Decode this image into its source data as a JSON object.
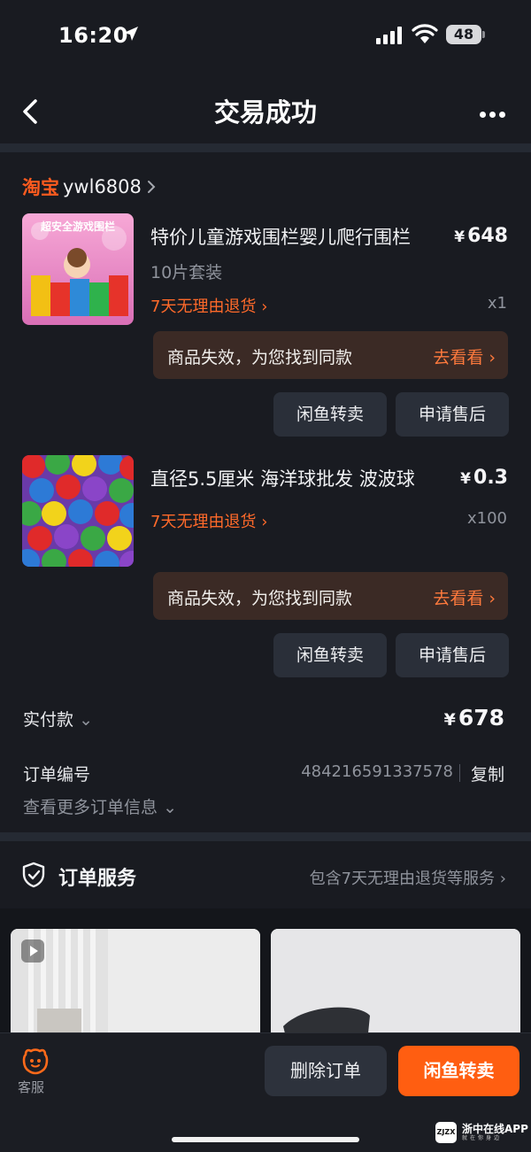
{
  "status_bar": {
    "time": "16:20",
    "battery": "48"
  },
  "nav": {
    "title": "交易成功"
  },
  "shop": {
    "platform": "淘宝",
    "name": "ywl6808"
  },
  "items": [
    {
      "title": "特价儿童游戏围栏婴儿爬行围栏",
      "sku": "10片套装",
      "return_tag": "7天无理由退货",
      "currency": "¥",
      "price": "648",
      "qty": "x1",
      "notice": "商品失效，为您找到同款",
      "notice_link": "去看看",
      "btn_resell": "闲鱼转卖",
      "btn_aftersale": "申请售后",
      "thumb_text": "超安全游戏围栏"
    },
    {
      "title": "直径5.5厘米 海洋球批发 波波球",
      "return_tag": "7天无理由退货",
      "currency": "¥",
      "price": "0.3",
      "qty": "x100",
      "notice": "商品失效，为您找到同款",
      "notice_link": "去看看",
      "btn_resell": "闲鱼转卖",
      "btn_aftersale": "申请售后"
    }
  ],
  "payment": {
    "label": "实付款",
    "currency": "¥",
    "amount": "678"
  },
  "order": {
    "label": "订单编号",
    "number": "484216591337578",
    "copy": "复制",
    "more": "查看更多订单信息"
  },
  "service": {
    "title": "订单服务",
    "desc": "包含7天无理由退货等服务"
  },
  "bottom": {
    "cs_label": "客服",
    "delete": "删除订单",
    "resell": "闲鱼转卖"
  },
  "watermark": {
    "logo": "ZJZX",
    "line1": "浙中在线APP",
    "line2": "就在你身边"
  },
  "colors": {
    "accent": "#ff5e11",
    "taobao": "#ff5b1f",
    "background": "#191b21"
  }
}
